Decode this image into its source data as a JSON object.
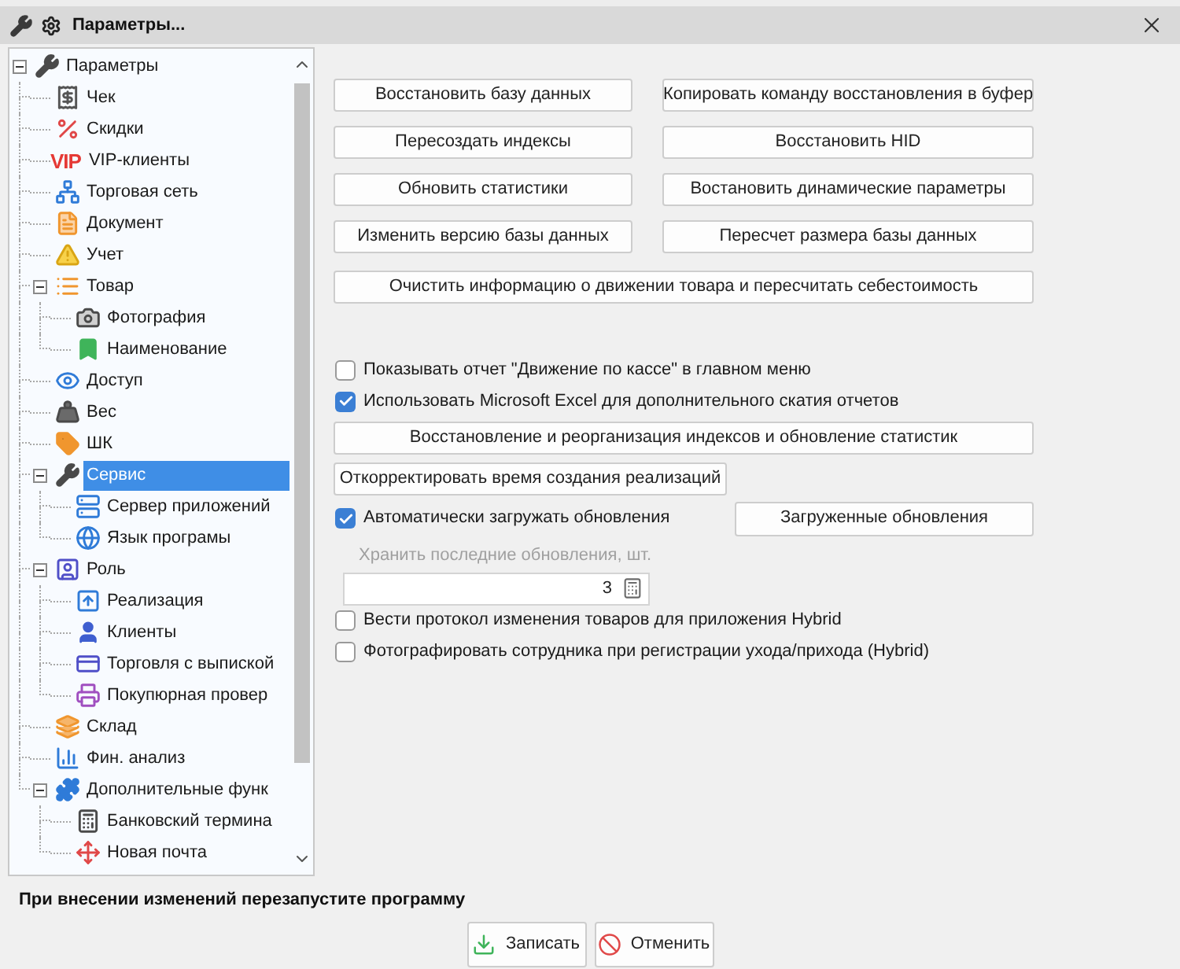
{
  "window": {
    "title": "Параметры..."
  },
  "tree": [
    {
      "label": "Параметры",
      "selected": false,
      "expanded": true,
      "children": [
        {
          "label": "Чек",
          "selected": false
        },
        {
          "label": "Скидки",
          "selected": false
        },
        {
          "label": "VIP-клиенты",
          "selected": false,
          "icon_text": "VIP"
        },
        {
          "label": "Торговая сеть",
          "selected": false
        },
        {
          "label": "Документ",
          "selected": false
        },
        {
          "label": "Учет",
          "selected": false
        },
        {
          "label": "Товар",
          "selected": false,
          "expanded": true,
          "children": [
            {
              "label": "Фотография",
              "selected": false
            },
            {
              "label": "Наименование",
              "selected": false
            }
          ]
        },
        {
          "label": "Доступ",
          "selected": false
        },
        {
          "label": "Вес",
          "selected": false
        },
        {
          "label": "ШК",
          "selected": false
        },
        {
          "label": "Сервис",
          "selected": true,
          "expanded": true,
          "children": [
            {
              "label": "Сервер приложений",
              "selected": false
            },
            {
              "label": "Язык програмы",
              "selected": false
            }
          ]
        },
        {
          "label": "Роль",
          "selected": false,
          "expanded": true,
          "children": [
            {
              "label": "Реализация",
              "selected": false
            },
            {
              "label": "Клиенты",
              "selected": false
            },
            {
              "label": "Торговля с выпиской",
              "selected": false
            },
            {
              "label": "Покупюрная провер",
              "selected": false
            }
          ]
        },
        {
          "label": "Склад",
          "selected": false
        },
        {
          "label": "Фин. анализ",
          "selected": false
        },
        {
          "label": "Дополнительные функ",
          "selected": false,
          "expanded": true,
          "children": [
            {
              "label": "Банковский термина",
              "selected": false
            },
            {
              "label": "Новая почта",
              "selected": false
            }
          ]
        }
      ]
    }
  ],
  "maintenance_buttons": [
    "Восстановить базу данных",
    "Копировать команду восстановления в буфер",
    "Пересоздать индексы",
    "Восстановить HID",
    "Обновить статистики",
    "Востановить динамические параметры",
    "Изменить версию базы данных",
    "Пересчет размера базы данных"
  ],
  "wide_button": "Очистить информацию о движении товара и пересчитать себестоимость",
  "options": [
    {
      "kind": "checkbox",
      "label": "Показывать отчет \"Движение по кассе\" в главном меню",
      "checked": false
    },
    {
      "kind": "checkbox",
      "label": "Использовать Microsoft Excel для дополнительного скатия отчетов",
      "checked": true
    },
    {
      "kind": "wide_button",
      "label": "Восстановление и реорганизация индексов и обновление статистик"
    },
    {
      "kind": "button",
      "label": "Откорректировать время создания реализаций"
    },
    {
      "kind": "checkbox_button",
      "label": "Автоматически загружать обновления",
      "checked": true,
      "button": "Загруженные обновления"
    },
    {
      "kind": "number_field",
      "label": "Хранить последние обновления, шт.",
      "value": "3",
      "disabled": true
    },
    {
      "kind": "checkbox",
      "label": "Вести протокол изменения товаров для приложения Hybrid",
      "checked": false
    },
    {
      "kind": "checkbox",
      "label": "Фотографировать сотрудника при регистрации ухода/прихода (Hybrid)",
      "checked": false
    }
  ],
  "footer": {
    "note": "При внесении изменений перезапустите программу",
    "buttons": [
      {
        "kind": "save",
        "label": "Записать"
      },
      {
        "kind": "cancel",
        "label": "Отменить"
      }
    ]
  }
}
